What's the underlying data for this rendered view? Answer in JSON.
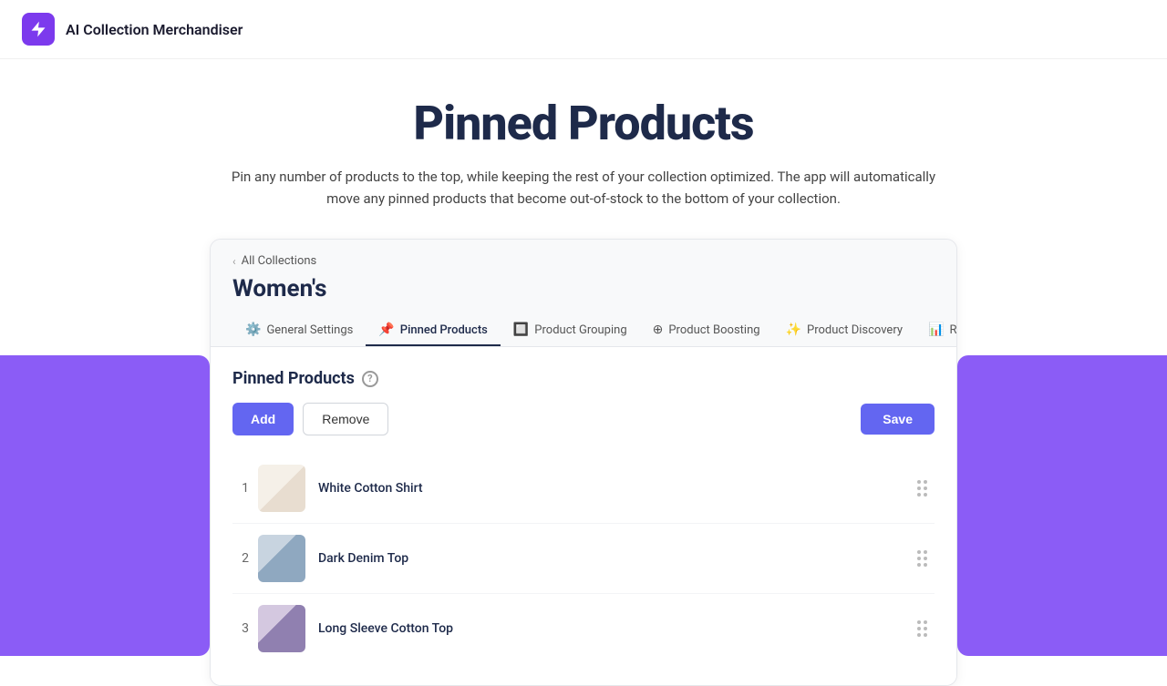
{
  "app": {
    "title": "AI Collection Merchandiser"
  },
  "page": {
    "heading": "Pinned Products",
    "description": "Pin any number of products to the top, while keeping the rest of your collection optimized. The app will automatically move any pinned products that become out-of-stock to the bottom of your collection."
  },
  "breadcrumb": {
    "link_text": "All Collections"
  },
  "collection": {
    "name": "Women's"
  },
  "tabs": [
    {
      "id": "general",
      "label": "General Settings",
      "icon": "⚙️",
      "active": false
    },
    {
      "id": "pinned",
      "label": "Pinned Products",
      "icon": "📌",
      "active": true
    },
    {
      "id": "grouping",
      "label": "Product Grouping",
      "icon": "🔲",
      "active": false
    },
    {
      "id": "boosting",
      "label": "Product Boosting",
      "icon": "⊕",
      "active": false
    },
    {
      "id": "discovery",
      "label": "Product Discovery",
      "icon": "✨",
      "active": false
    },
    {
      "id": "ranking",
      "label": "Ranking Data",
      "icon": "📊",
      "active": false
    }
  ],
  "section": {
    "title": "Pinned Products"
  },
  "buttons": {
    "add": "Add",
    "remove": "Remove",
    "save": "Save"
  },
  "products": [
    {
      "position": "1",
      "name": "White Cotton Shirt"
    },
    {
      "position": "2",
      "name": "Dark Denim Top"
    },
    {
      "position": "3",
      "name": "Long Sleeve Cotton Top"
    }
  ]
}
